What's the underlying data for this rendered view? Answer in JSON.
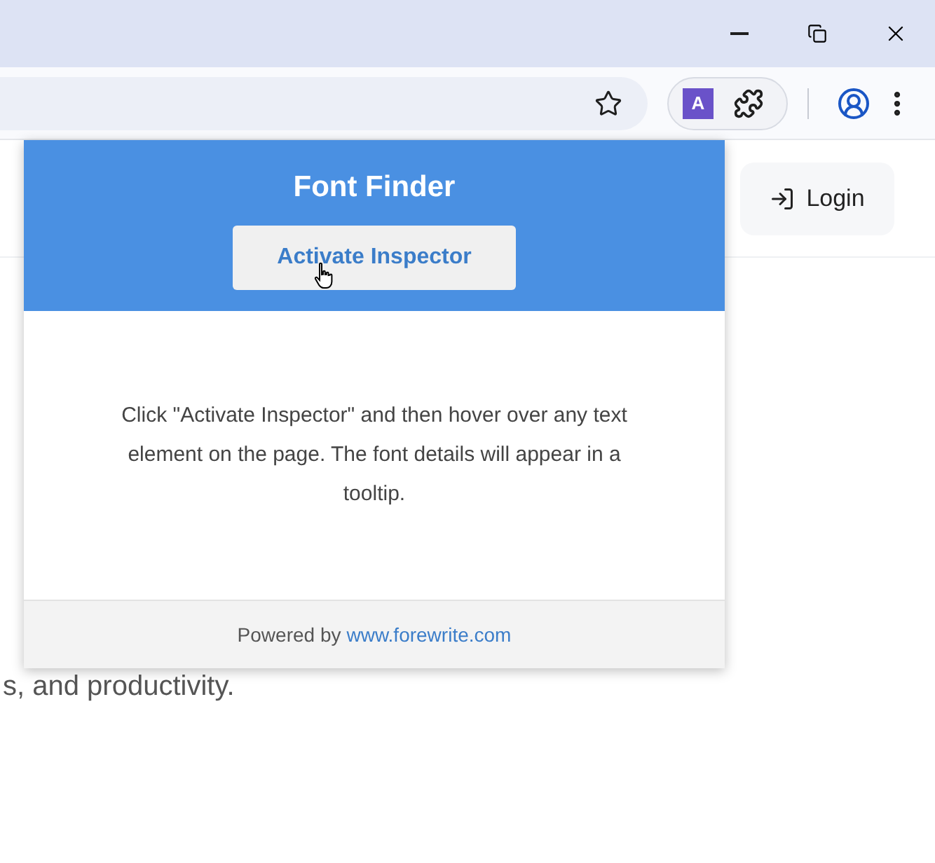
{
  "toolbar": {
    "extension_badge": "A"
  },
  "page": {
    "login_button": "Login",
    "subtitle_fragment": "s, and productivity."
  },
  "popup": {
    "title": "Font Finder",
    "button": "Activate Inspector",
    "description": "Click \"Activate Inspector\" and then hover over any text element on the page. The font details will appear in a tooltip.",
    "footer": {
      "prefix": "Powered by",
      "link": "www.forewrite.com"
    }
  }
}
